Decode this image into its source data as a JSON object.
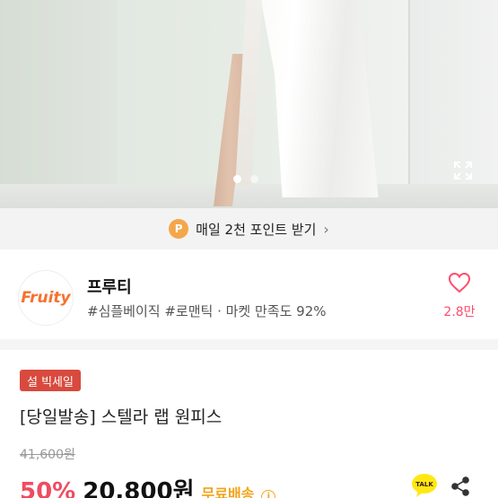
{
  "photo": {
    "icons": [
      "expand-icon"
    ],
    "slide_count": 2,
    "active_slide": 1
  },
  "point_banner": {
    "badge": "P",
    "text": "매일 2천 포인트 받기",
    "chevron": "›"
  },
  "seller": {
    "logo_text": "Fruity",
    "name": "프루티",
    "tags": "#심플베이직 #로맨틱 · 마켓 만족도 92%",
    "like_count": "2.8만",
    "accent_color": "#ff4b6b"
  },
  "product": {
    "sale_badge": "설 빅세일",
    "title": "[당일발송] 스텔라 랩 원피스",
    "original_price": "41,600원",
    "discount": "50%",
    "price": "20,800원",
    "shipping": "무료배송",
    "info_icon": "i",
    "talk_label": "TALK"
  }
}
